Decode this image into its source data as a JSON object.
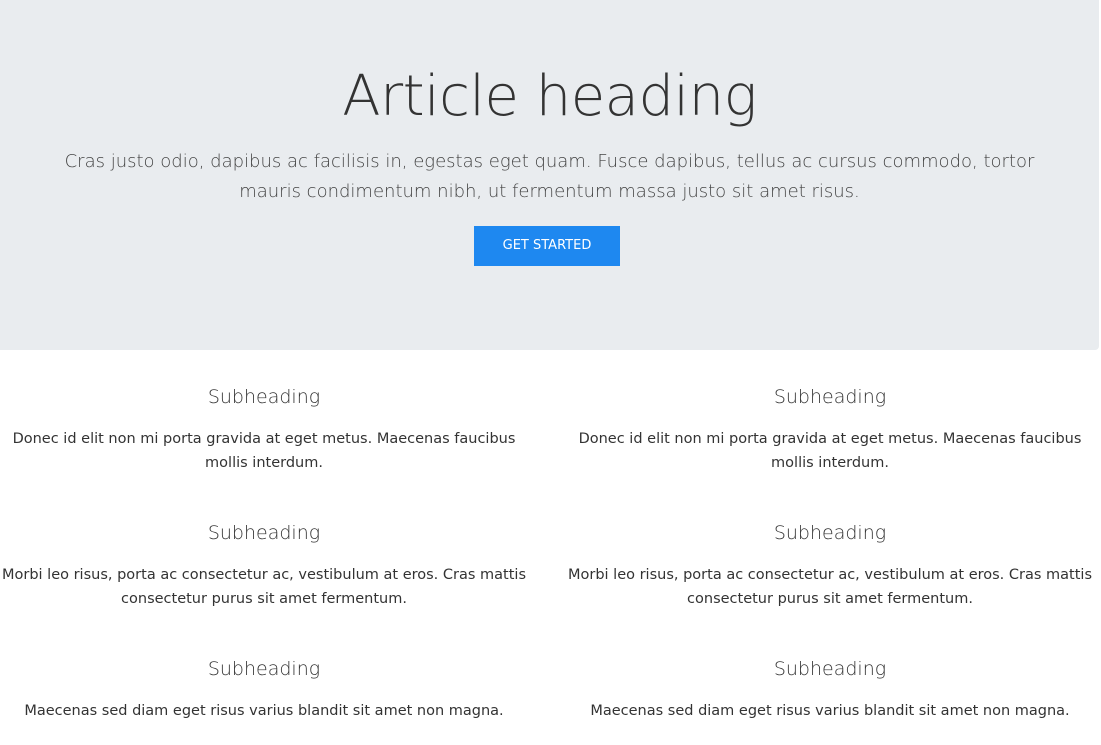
{
  "hero": {
    "title": "Article heading",
    "lead": "Cras justo odio, dapibus ac facilisis in, egestas eget quam. Fusce dapibus, tellus ac cursus commodo, tortor mauris condimentum nibh, ut fermentum massa justo sit amet risus.",
    "button_label": "GET STARTED",
    "background_color": "#e9ecef",
    "button_color": "#1e88f0"
  },
  "columns": [
    {
      "items": [
        {
          "heading": "Subheading",
          "text": "Donec id elit non mi porta gravida at eget metus. Maecenas faucibus mollis interdum."
        },
        {
          "heading": "Subheading",
          "text": "Morbi leo risus, porta ac consectetur ac, vestibulum at eros. Cras mattis consectetur purus sit amet fermentum."
        },
        {
          "heading": "Subheading",
          "text": "Maecenas sed diam eget risus varius blandit sit amet non magna."
        }
      ]
    },
    {
      "items": [
        {
          "heading": "Subheading",
          "text": "Donec id elit non mi porta gravida at eget metus. Maecenas faucibus mollis interdum."
        },
        {
          "heading": "Subheading",
          "text": "Morbi leo risus, porta ac consectetur ac, vestibulum at eros. Cras mattis consectetur purus sit amet fermentum."
        },
        {
          "heading": "Subheading",
          "text": "Maecenas sed diam eget risus varius blandit sit amet non magna."
        }
      ]
    }
  ]
}
